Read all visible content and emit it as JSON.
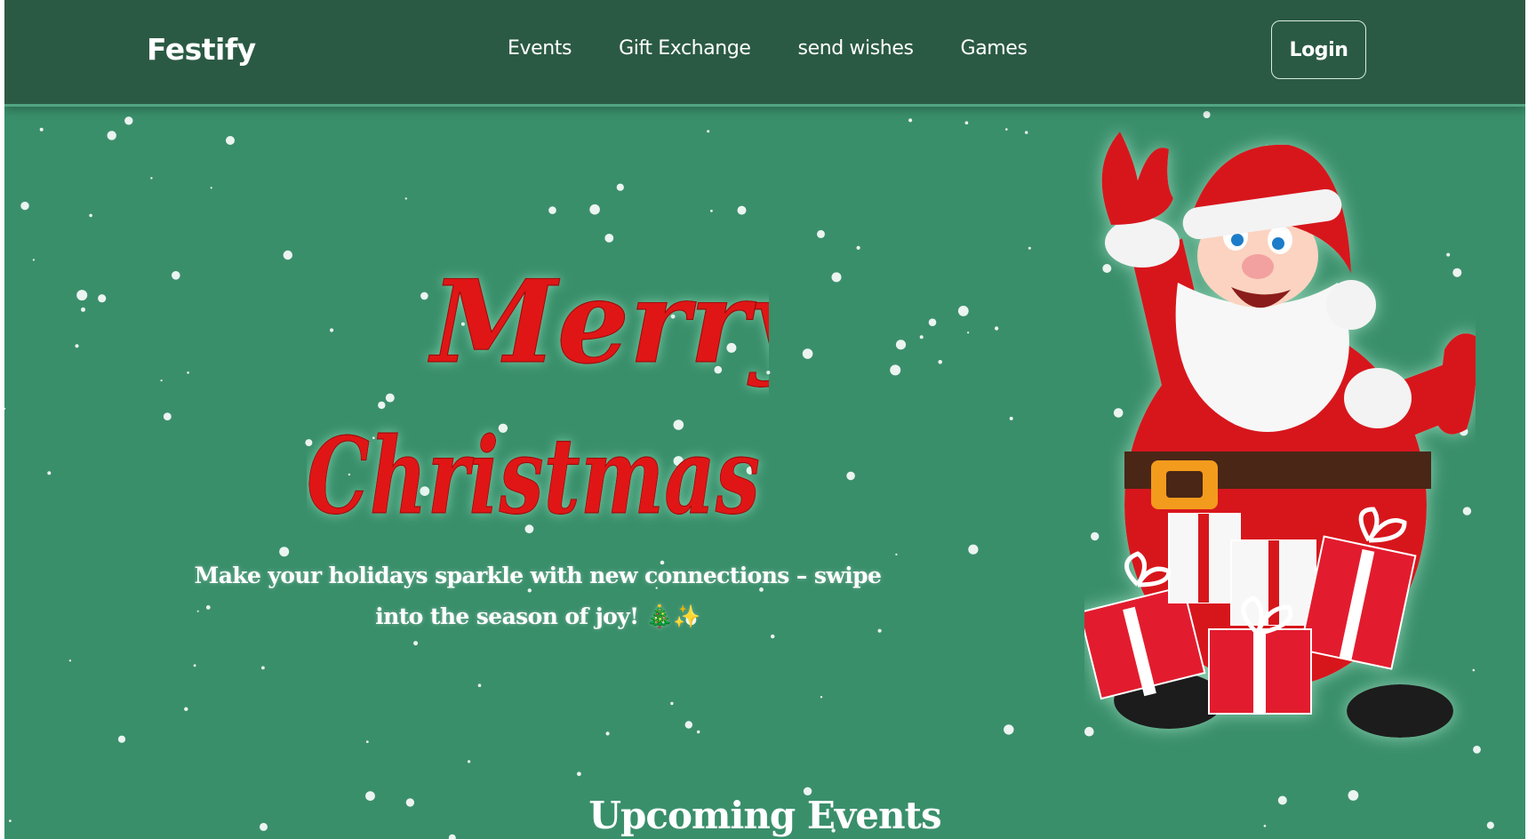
{
  "brand": {
    "name": "Festify"
  },
  "nav": {
    "items": [
      {
        "label": "Events"
      },
      {
        "label": "Gift Exchange"
      },
      {
        "label": "send wishes"
      },
      {
        "label": "Games"
      }
    ],
    "login_label": "Login"
  },
  "hero": {
    "headline_line1": "Merry",
    "headline_line2": "Christmas",
    "tagline": "Make your holidays sparkle with new connections – swipe into the season of joy! 🎄✨"
  },
  "sections": {
    "upcoming_title": "Upcoming Events"
  },
  "colors": {
    "page_bg": "#3a8f6b",
    "navbar_bg": "#2b5a44",
    "headline_red": "#e01515",
    "text": "#ffffff"
  },
  "icons": {
    "hero_art": "santa-with-gifts-illustration",
    "background": "falling-snow"
  }
}
